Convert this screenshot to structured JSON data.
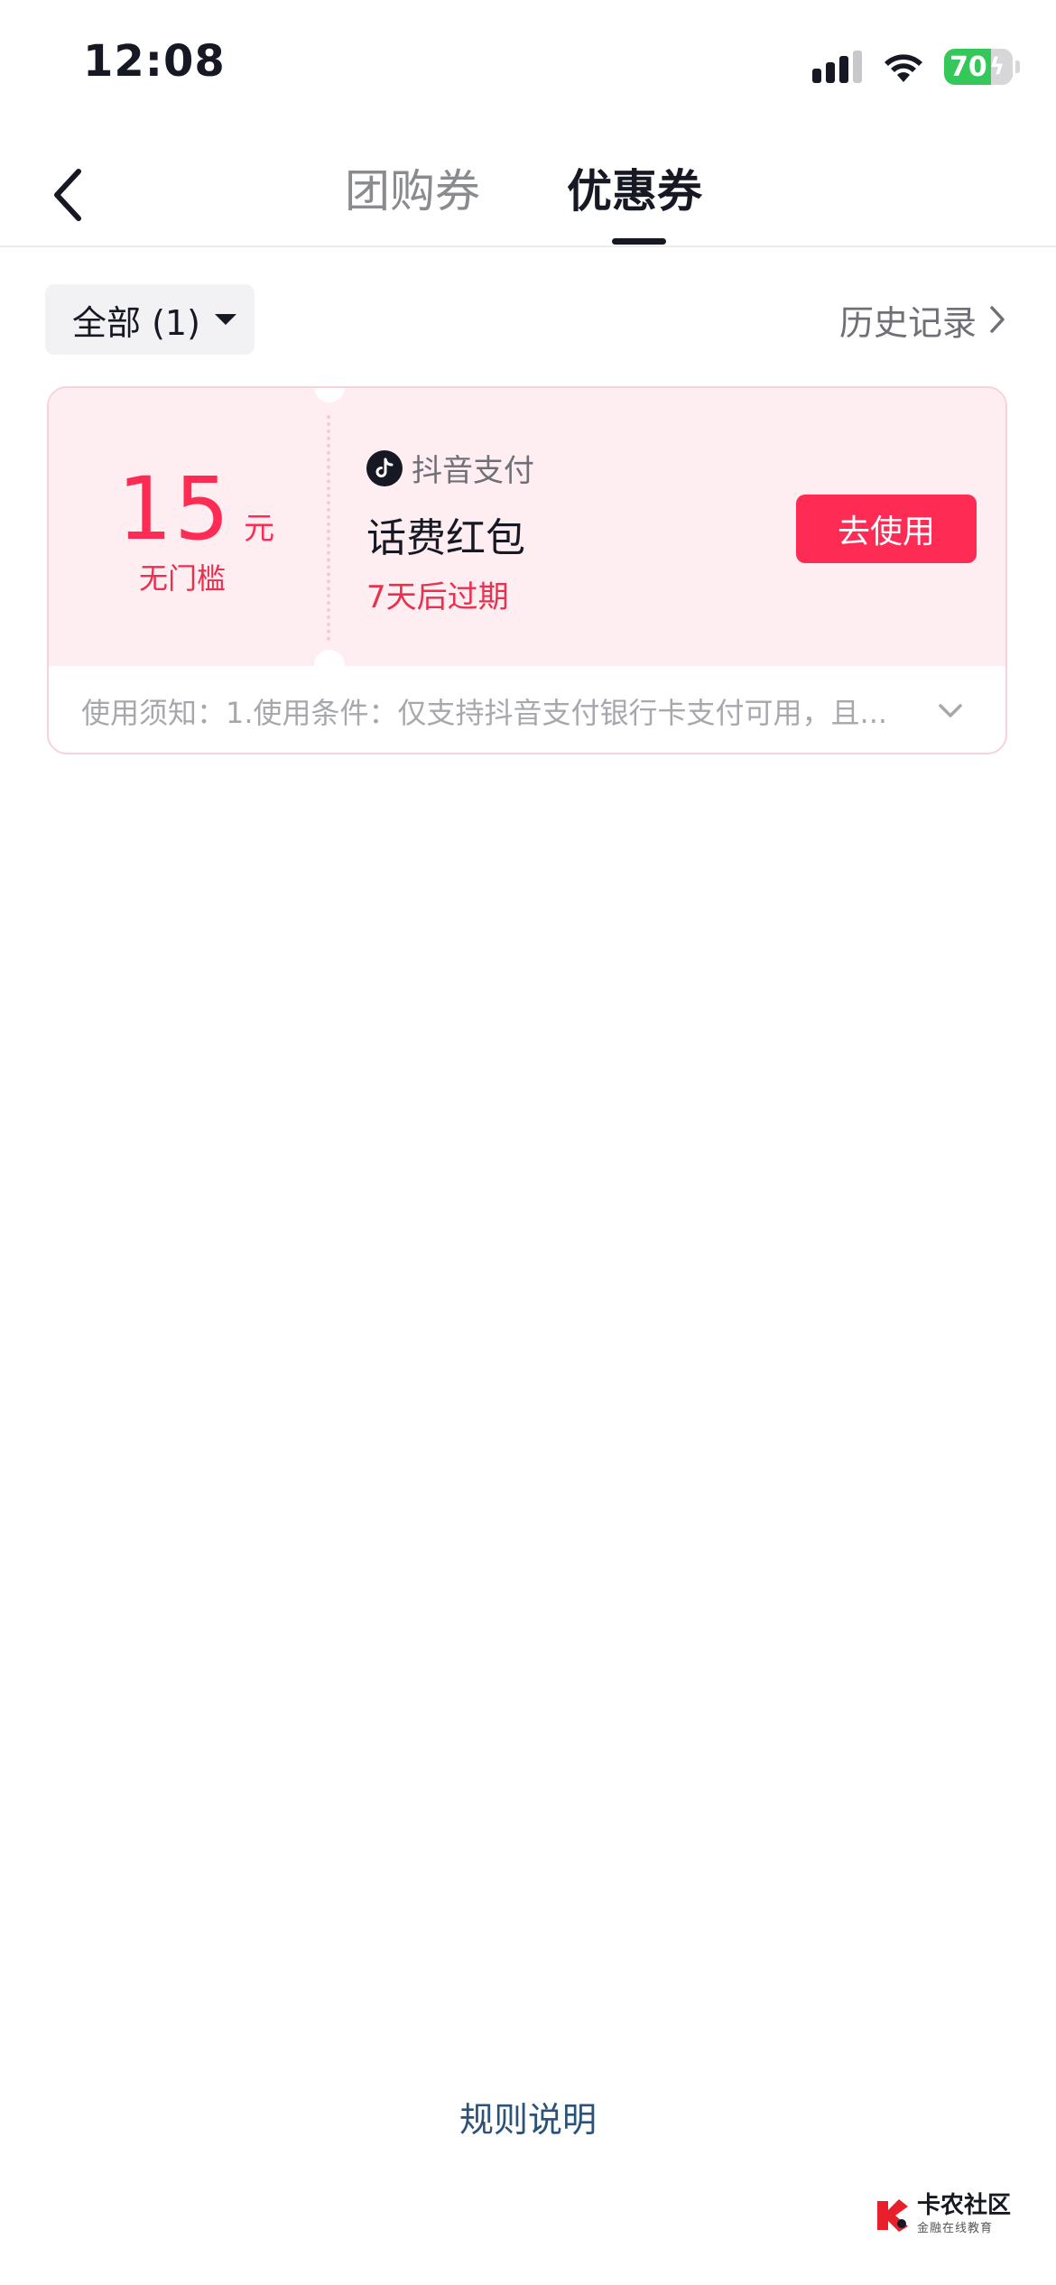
{
  "status_bar": {
    "time": "12:08",
    "battery": "70"
  },
  "nav": {
    "tabs": [
      {
        "label": "团购券",
        "active": false
      },
      {
        "label": "优惠券",
        "active": true
      }
    ]
  },
  "filter": {
    "label": "全部 (1)",
    "history_label": "历史记录"
  },
  "coupon": {
    "amount": "15",
    "unit": "元",
    "threshold": "无门槛",
    "provider": "抖音支付",
    "name": "话费红包",
    "expiry": "7天后过期",
    "button_label": "去使用",
    "notice": "使用须知：1.使用条件：仅支持抖音支付银行卡支付可用，且..."
  },
  "footer": {
    "rules_label": "规则说明",
    "watermark_title": "卡农社区",
    "watermark_subtitle": "金融在线教育"
  },
  "colors": {
    "accent": "#fe2c55",
    "card_bg": "#feeef1",
    "text_primary": "#161823",
    "text_secondary": "#6f7077"
  }
}
